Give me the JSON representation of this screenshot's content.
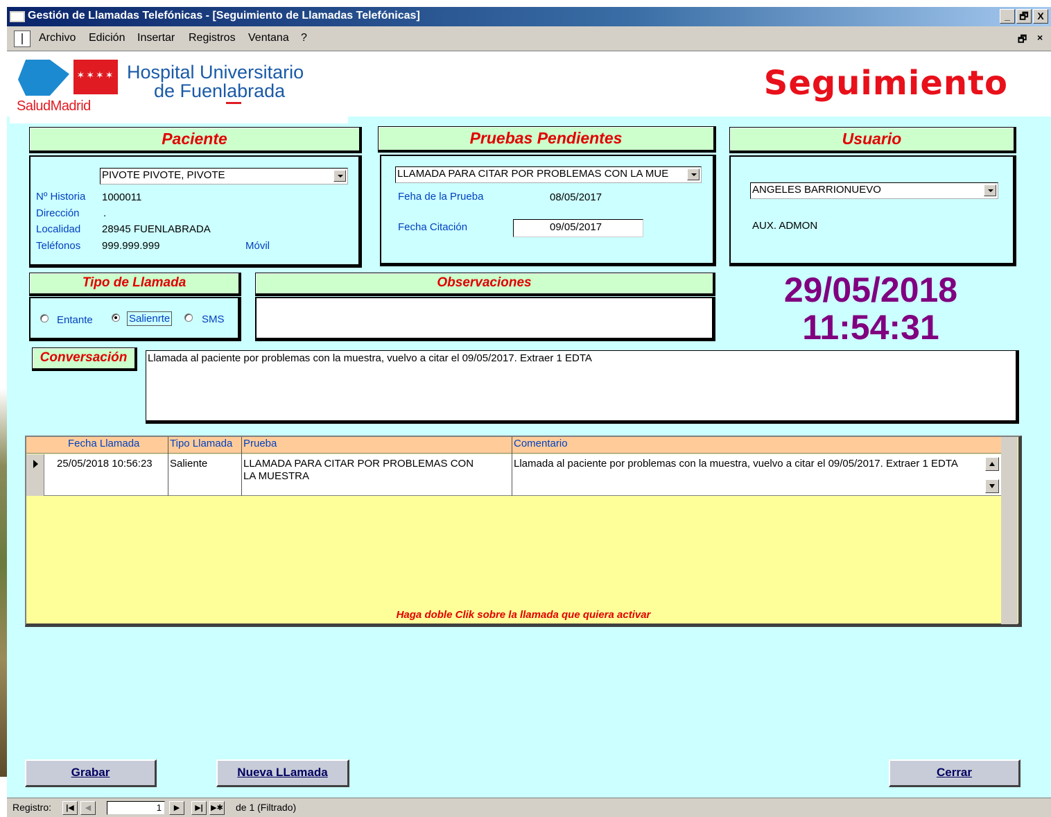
{
  "window": {
    "title": "Gestión de Llamadas Telefónicas - [Seguimiento de Llamadas Telefónicas]",
    "minimize": "_",
    "restore": "🗗",
    "close": "X",
    "mdi_restore": "🗗",
    "mdi_close": "×"
  },
  "menu": [
    "Archivo",
    "Edición",
    "Insertar",
    "Registros",
    "Ventana",
    "?"
  ],
  "header": {
    "logo_text": "SaludMadrid",
    "logo_stars": "✶✶✶✶",
    "hospital_line1": "Hospital Universitario",
    "hospital_line2": "de Fuenlabrada",
    "form_title": "Seguimiento"
  },
  "paciente": {
    "heading": "Paciente",
    "name": "PIVOTE PIVOTE, PIVOTE",
    "historia_label": "Nº Historia",
    "historia": "1000011",
    "direccion_label": "Dirección",
    "direccion": ".",
    "localidad_label": "Localidad",
    "localidad": "28945 FUENLABRADA",
    "telefonos_label": "Teléfonos",
    "telefonos": "999.999.999",
    "movil_label": "Móvil"
  },
  "pruebas": {
    "heading": "Pruebas Pendientes",
    "selected": "LLAMADA PARA CITAR POR PROBLEMAS CON LA MUE",
    "fecha_prueba_label": "Feha de la Prueba",
    "fecha_prueba": "08/05/2017",
    "fecha_citacion_label": "Fecha Citación",
    "fecha_citacion": "09/05/2017"
  },
  "usuario": {
    "heading": "Usuario",
    "name": "ANGELES BARRIONUEVO",
    "role": "AUX. ADMON"
  },
  "tipo_llamada": {
    "heading": "Tipo de Llamada",
    "options": [
      "Entante",
      "Salienrte",
      "SMS"
    ],
    "selected": "Salienrte"
  },
  "observaciones": {
    "heading": "Observaciones",
    "text": ""
  },
  "clock": {
    "date": "29/05/2018",
    "time": "11:54:31"
  },
  "conversacion": {
    "heading": "Conversación",
    "text": "Llamada al paciente por problemas con la muestra, vuelvo a citar el 09/05/2017. Extraer 1 EDTA"
  },
  "table": {
    "columns": [
      "Fecha Llamada",
      "Tipo Llamada",
      "Prueba",
      "Comentario"
    ],
    "rows": [
      {
        "fecha": "25/05/2018 10:56:23",
        "tipo": "Saliente",
        "prueba_line1": "LLAMADA PARA CITAR POR PROBLEMAS CON",
        "prueba_line2": "LA MUESTRA",
        "comentario": "Llamada al paciente por problemas con la muestra, vuelvo a citar el 09/05/2017. Extraer 1 EDTA"
      }
    ],
    "hint": "Haga doble Clik sobre la llamada que quiera activar"
  },
  "buttons": {
    "grabar": "Grabar",
    "nueva": "Nueva LLamada",
    "cerrar": "Cerrar"
  },
  "status": {
    "registro_label": "Registro:",
    "current": "1",
    "total_text": "de  1 (Filtrado)"
  }
}
